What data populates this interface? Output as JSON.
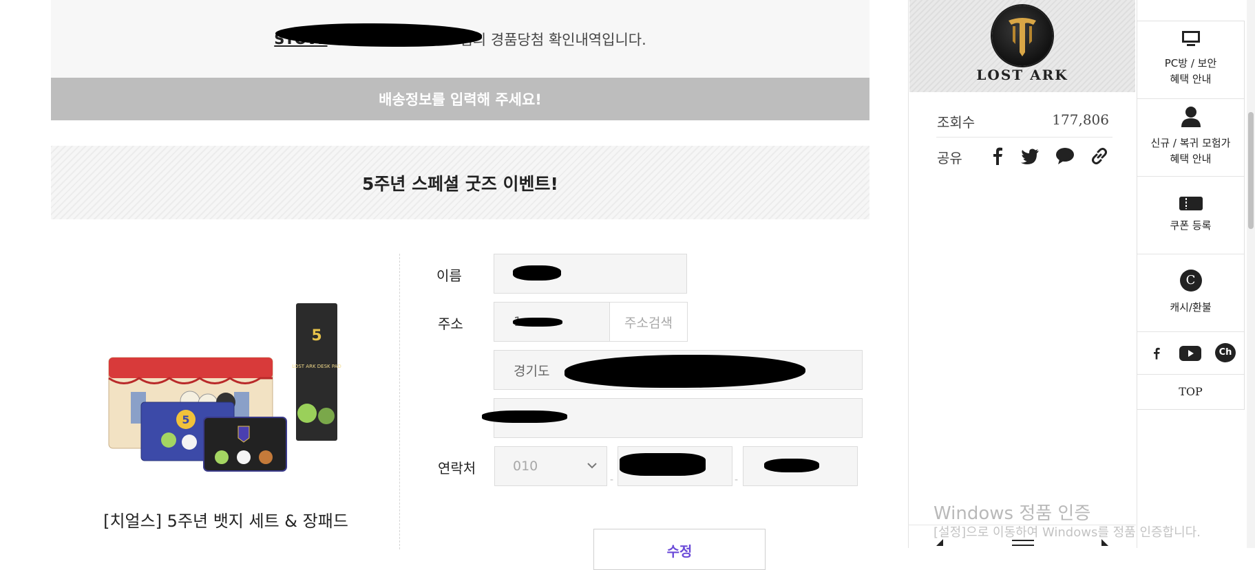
{
  "notice": {
    "user_prefix": "STOVE",
    "message": "님의 경품당첨 확인내역입니다."
  },
  "shipping_banner": "배송정보를 입력해 주세요!",
  "event_banner": "5주년 스페셜 굿즈 이벤트!",
  "product": {
    "name": "[치얼스] 5주년 뱃지 세트 & 장패드",
    "box_text": "LOST ARK DESK PAD"
  },
  "form": {
    "name_label": "이름",
    "address_label": "주소",
    "zip_value": "1",
    "address_search": "주소검색",
    "address_line1": "경기도",
    "address_line2": "",
    "phone_label": "연락처",
    "phone_prefix": "010",
    "phone_separator": "-",
    "edit_button": "수정"
  },
  "side": {
    "logo_text": "LOST ARK",
    "views_label": "조회수",
    "views_value": "177,806",
    "share_label": "공유",
    "share_icons": [
      "facebook-icon",
      "twitter-icon",
      "chat-bubble-icon",
      "link-icon"
    ]
  },
  "quick_menu": {
    "pc_line1": "PC방 / 보안",
    "pc_line2": "혜택 안내",
    "new_line1": "신규 / 복귀 모험가",
    "new_line2": "혜택 안내",
    "coupon": "쿠폰 등록",
    "cash": "캐시/환불",
    "top": "TOP",
    "cash_glyph": "C",
    "ch_glyph": "Ch"
  },
  "watermark": {
    "title": "Windows 정품 인증",
    "subtitle": "[설정]으로 이동하여 Windows를 정품 인증합니다."
  },
  "colors": {
    "banner_gray": "#bdbdbd",
    "accent_purple": "#6b4bd8"
  }
}
